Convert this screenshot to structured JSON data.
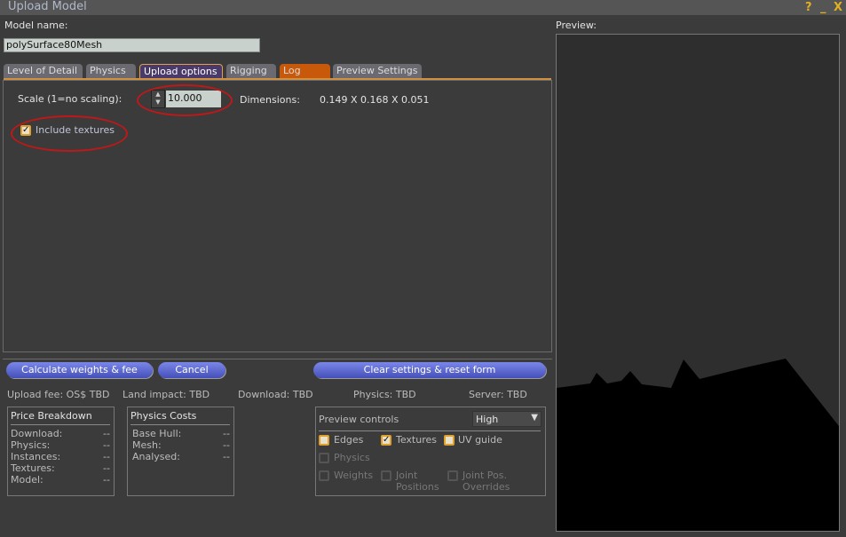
{
  "window": {
    "title": "Upload Model",
    "help_icon": "?",
    "minimize_icon": "_",
    "close_icon": "X"
  },
  "model_name": {
    "label": "Model name:",
    "value": "polySurface80Mesh"
  },
  "tabs": [
    {
      "label": "Level of Detail"
    },
    {
      "label": "Physics"
    },
    {
      "label": "Upload options",
      "active": true
    },
    {
      "label": "Rigging"
    },
    {
      "label": "Log"
    },
    {
      "label": "Preview Settings"
    }
  ],
  "upload_options": {
    "scale_label": "Scale (1=no scaling):",
    "scale_value": "10.000",
    "dimensions_label": "Dimensions:",
    "dimensions_value": "0.149 X 0.168 X 0.051",
    "include_textures_label": "Include textures",
    "include_textures_checked": true
  },
  "buttons": {
    "calculate": "Calculate weights & fee",
    "cancel": "Cancel",
    "clear": "Clear settings & reset form"
  },
  "status": {
    "upload_fee": "Upload fee: OS$ TBD",
    "land_impact": "Land impact: TBD",
    "download": "Download: TBD",
    "physics": "Physics: TBD",
    "server": "Server: TBD"
  },
  "price_breakdown": {
    "title": "Price Breakdown",
    "rows": [
      {
        "label": "Download:",
        "value": "--"
      },
      {
        "label": "Physics:",
        "value": "--"
      },
      {
        "label": "Instances:",
        "value": "--"
      },
      {
        "label": "Textures:",
        "value": "--"
      },
      {
        "label": "Model:",
        "value": "--"
      }
    ]
  },
  "physics_costs": {
    "title": "Physics Costs",
    "rows": [
      {
        "label": "Base Hull:",
        "value": "--"
      },
      {
        "label": "Mesh:",
        "value": "--"
      },
      {
        "label": "Analysed:",
        "value": "--"
      }
    ]
  },
  "preview_controls": {
    "title": "Preview controls",
    "quality": "High",
    "edges": "Edges",
    "textures": "Textures",
    "uv_guide": "UV guide",
    "physics": "Physics",
    "weights": "Weights",
    "joint_positions": "Joint Positions",
    "joint_pos_overrides": "Joint Pos. Overrides",
    "checked": {
      "edges": false,
      "textures": true,
      "uv_guide": false
    }
  },
  "preview": {
    "label": "Preview:"
  },
  "colors": {
    "accent": "#d09040",
    "button": "#5a66d0",
    "highlight": "#c01818"
  }
}
